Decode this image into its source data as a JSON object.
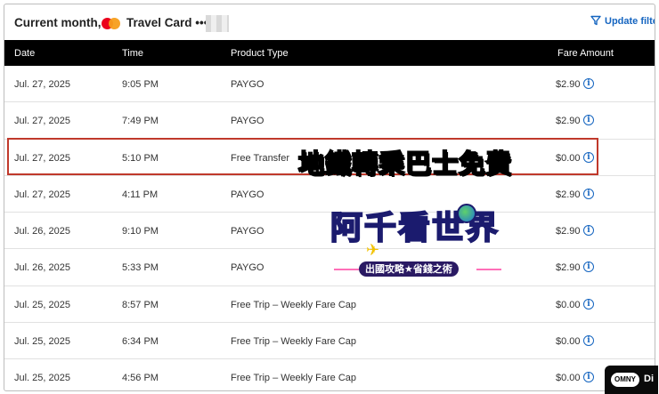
{
  "header": {
    "title": "Current month,",
    "card_label": "Travel Card •••",
    "filter_label": "Update filter"
  },
  "table": {
    "columns": [
      "Date",
      "Time",
      "Product Type",
      "Fare Amount"
    ],
    "rows": [
      {
        "date": "Jul. 27, 2025",
        "time": "9:05 PM",
        "product": "PAYGO",
        "fare": "$2.90"
      },
      {
        "date": "Jul. 27, 2025",
        "time": "7:49 PM",
        "product": "PAYGO",
        "fare": "$2.90"
      },
      {
        "date": "Jul. 27, 2025",
        "time": "5:10 PM",
        "product": "Free Transfer",
        "fare": "$0.00"
      },
      {
        "date": "Jul. 27, 2025",
        "time": "4:11 PM",
        "product": "PAYGO",
        "fare": "$2.90"
      },
      {
        "date": "Jul. 26, 2025",
        "time": "9:10 PM",
        "product": "PAYGO",
        "fare": "$2.90"
      },
      {
        "date": "Jul. 26, 2025",
        "time": "5:33 PM",
        "product": "PAYGO",
        "fare": "$2.90"
      },
      {
        "date": "Jul. 25, 2025",
        "time": "8:57 PM",
        "product": "Free Trip – Weekly Fare Cap",
        "fare": "$0.00"
      },
      {
        "date": "Jul. 25, 2025",
        "time": "6:34 PM",
        "product": "Free Trip – Weekly Fare Cap",
        "fare": "$0.00"
      },
      {
        "date": "Jul. 25, 2025",
        "time": "4:56 PM",
        "product": "Free Trip – Weekly Fare Cap",
        "fare": "$0.00"
      }
    ]
  },
  "annotation": {
    "caption": "地鐵轉乘巴士免費"
  },
  "watermark": {
    "name": "阿千看世界",
    "slogan": "出國攻略★省錢之術"
  },
  "omny_badge": {
    "logo": "OMNY",
    "text": "Di"
  },
  "colors": {
    "header_bg": "#000000",
    "link": "#1565c0",
    "highlight": "#c0392b",
    "caption": "#ffd200"
  },
  "icons": [
    "mastercard-icon",
    "filter-icon",
    "info-icon"
  ]
}
